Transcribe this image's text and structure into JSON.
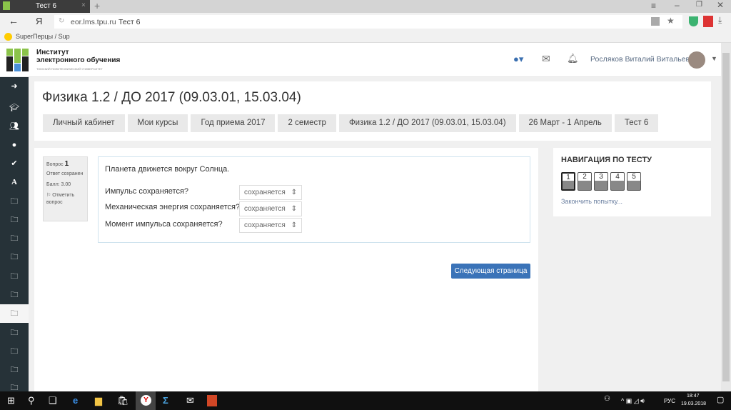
{
  "browser": {
    "tab_title": "Тест 6",
    "url_domain": "eor.lms.tpu.ru",
    "url_title": "Тест 6",
    "bookmark": "SuperПерцы / Sup"
  },
  "header": {
    "logo_line1": "Институт",
    "logo_line2": "электронного обучения",
    "logo_sub": "ТОМСКИЙ ПОЛИТЕХНИЧЕСКИЙ УНИВЕРСИТЕТ",
    "user_name": "Росляков Виталий Витальевич"
  },
  "page": {
    "title": "Физика 1.2 / ДО 2017 (09.03.01, 15.03.04)",
    "breadcrumbs": [
      "Личный кабинет",
      "Мои курсы",
      "Год приема 2017",
      "2 семестр",
      "Физика 1.2 / ДО 2017 (09.03.01, 15.03.04)",
      "26 Март - 1 Апрель",
      "Тест 6"
    ]
  },
  "question": {
    "label": "Вопрос",
    "number": "1",
    "status": "Ответ сохранен",
    "score": "Балл: 3.00",
    "flag": "Отметить вопрос",
    "text": "Планета движется вокруг Солнца.",
    "items": [
      {
        "q": "Импульс сохраняется?",
        "a": "сохраняется"
      },
      {
        "q": "Механическая энергия сохраняется?",
        "a": "сохраняется"
      },
      {
        "q": "Момент импульса сохраняется?",
        "a": "сохраняется"
      }
    ],
    "next": "Следующая страница"
  },
  "nav": {
    "title": "НАВИГАЦИЯ ПО ТЕСТУ",
    "buttons": [
      "1",
      "2",
      "3",
      "4",
      "5"
    ],
    "finish": "Закончить попытку..."
  },
  "taskbar": {
    "lang": "РУС",
    "time": "18:47",
    "date": "19.03.2018"
  }
}
